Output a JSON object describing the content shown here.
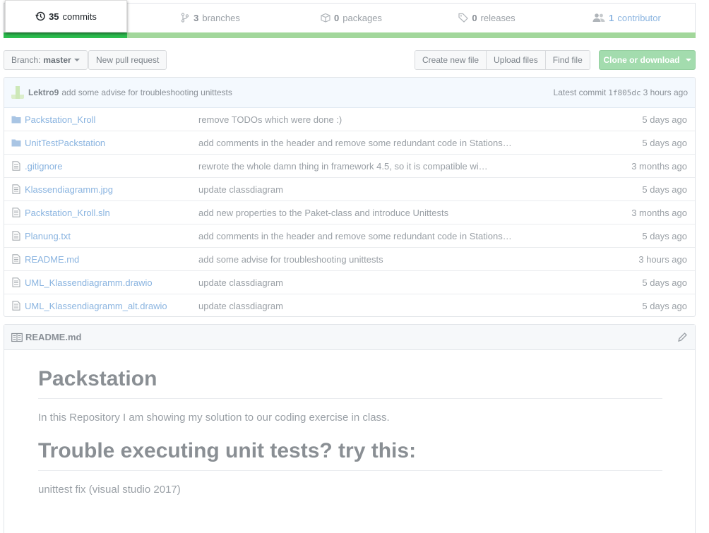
{
  "summary": {
    "commits": {
      "count": "35",
      "label": "commits"
    },
    "branches": {
      "count": "3",
      "label": "branches"
    },
    "packages": {
      "count": "0",
      "label": "packages"
    },
    "releases": {
      "count": "0",
      "label": "releases"
    },
    "contributors": {
      "count": "1",
      "label": "contributor"
    }
  },
  "toolbar": {
    "branch_prefix": "Branch:",
    "branch_name": "master",
    "new_pull_request": "New pull request",
    "create_new_file": "Create new file",
    "upload_files": "Upload files",
    "find_file": "Find file",
    "clone_or_download": "Clone or download"
  },
  "latest_commit": {
    "author": "Lektro9",
    "message": "add some advise for troubleshooting unittests",
    "label": "Latest commit",
    "sha": "1f805dc",
    "age": "3 hours ago"
  },
  "files": [
    {
      "type": "folder",
      "name": "Packstation_Kroll",
      "message": "remove TODOs which were done :)",
      "age": "5 days ago"
    },
    {
      "type": "folder",
      "name": "UnitTestPackstation",
      "message": "add comments in the header and remove some redundant code in Stations…",
      "age": "5 days ago"
    },
    {
      "type": "file",
      "name": ".gitignore",
      "message": "rewrote the whole damn thing in framework 4.5, so it is compatible wi…",
      "age": "3 months ago"
    },
    {
      "type": "file",
      "name": "Klassendiagramm.jpg",
      "message": "update classdiagram",
      "age": "5 days ago"
    },
    {
      "type": "file",
      "name": "Packstation_Kroll.sln",
      "message": "add new properties to the Paket-class and introduce Unittests",
      "age": "3 months ago"
    },
    {
      "type": "file",
      "name": "Planung.txt",
      "message": "add comments in the header and remove some redundant code in Stations…",
      "age": "5 days ago"
    },
    {
      "type": "file",
      "name": "README.md",
      "message": "add some advise for troubleshooting unittests",
      "age": "3 hours ago"
    },
    {
      "type": "file",
      "name": "UML_Klassendiagramm.drawio",
      "message": "update classdiagram",
      "age": "5 days ago"
    },
    {
      "type": "file",
      "name": "UML_Klassendiagramm_alt.drawio",
      "message": "update classdiagram",
      "age": "5 days ago"
    }
  ],
  "readme": {
    "filename": "README.md",
    "heading1": "Packstation",
    "paragraph1": "In this Repository I am showing my solution to our coding exercise in class.",
    "heading2": "Trouble executing unit tests? try this:",
    "paragraph2": "unittest fix (visual studio 2017)"
  },
  "colors": {
    "link": "#8ab4e0",
    "clone_button": "#a3dcae",
    "language_bar": "#a2d79b",
    "active_bar": "#2cbe4e"
  }
}
